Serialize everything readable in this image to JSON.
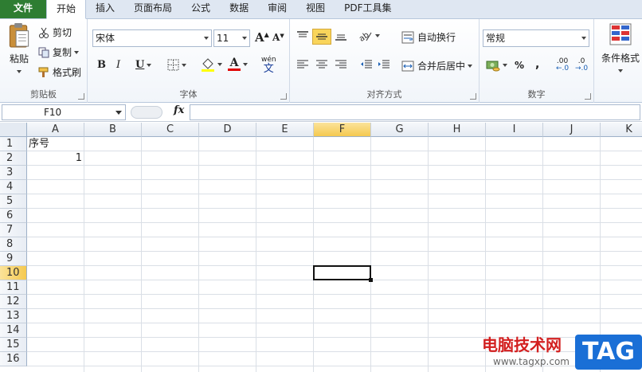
{
  "tabs": [
    {
      "label": "文件",
      "kind": "file"
    },
    {
      "label": "开始",
      "kind": "active"
    },
    {
      "label": "插入"
    },
    {
      "label": "页面布局"
    },
    {
      "label": "公式"
    },
    {
      "label": "数据"
    },
    {
      "label": "审阅"
    },
    {
      "label": "视图"
    },
    {
      "label": "PDF工具集"
    }
  ],
  "clipboard": {
    "paste": "粘贴",
    "cut": "剪切",
    "copy": "复制",
    "format_painter": "格式刷",
    "label": "剪贴板"
  },
  "font": {
    "name": "宋体",
    "size": "11",
    "label": "字体",
    "bold": "B",
    "italic": "I",
    "underline": "U",
    "grow": "A",
    "shrink": "A",
    "color_letter": "A",
    "phonetic": "wén",
    "phonetic_char": "文"
  },
  "alignment": {
    "wrap": "自动换行",
    "merge": "合并后居中",
    "label": "对齐方式"
  },
  "number": {
    "format": "常规",
    "percent": "%",
    "comma": ",",
    "inc": ".00",
    "dec": ".0",
    "label": "数字"
  },
  "styles": {
    "cond": "条件格式"
  },
  "formula_bar": {
    "name_box": "F10",
    "fx": "fx",
    "value": ""
  },
  "columns": [
    "A",
    "B",
    "C",
    "D",
    "E",
    "F",
    "G",
    "H",
    "I",
    "J",
    "K"
  ],
  "rows": [
    "1",
    "2",
    "3",
    "4",
    "5",
    "6",
    "7",
    "8",
    "9",
    "10",
    "11",
    "12",
    "13",
    "14",
    "15",
    "16"
  ],
  "selected": {
    "col": "F",
    "row": "10"
  },
  "cells": {
    "A1": "序号",
    "A2": "1"
  },
  "watermark": {
    "text": "电脑技术网",
    "url": "www.tagxp.com",
    "badge": "TAG"
  },
  "colors": {
    "file_tab": "#2e7d32",
    "selected_header": "#f5c94f",
    "highlight_button": "#f9d55b"
  }
}
